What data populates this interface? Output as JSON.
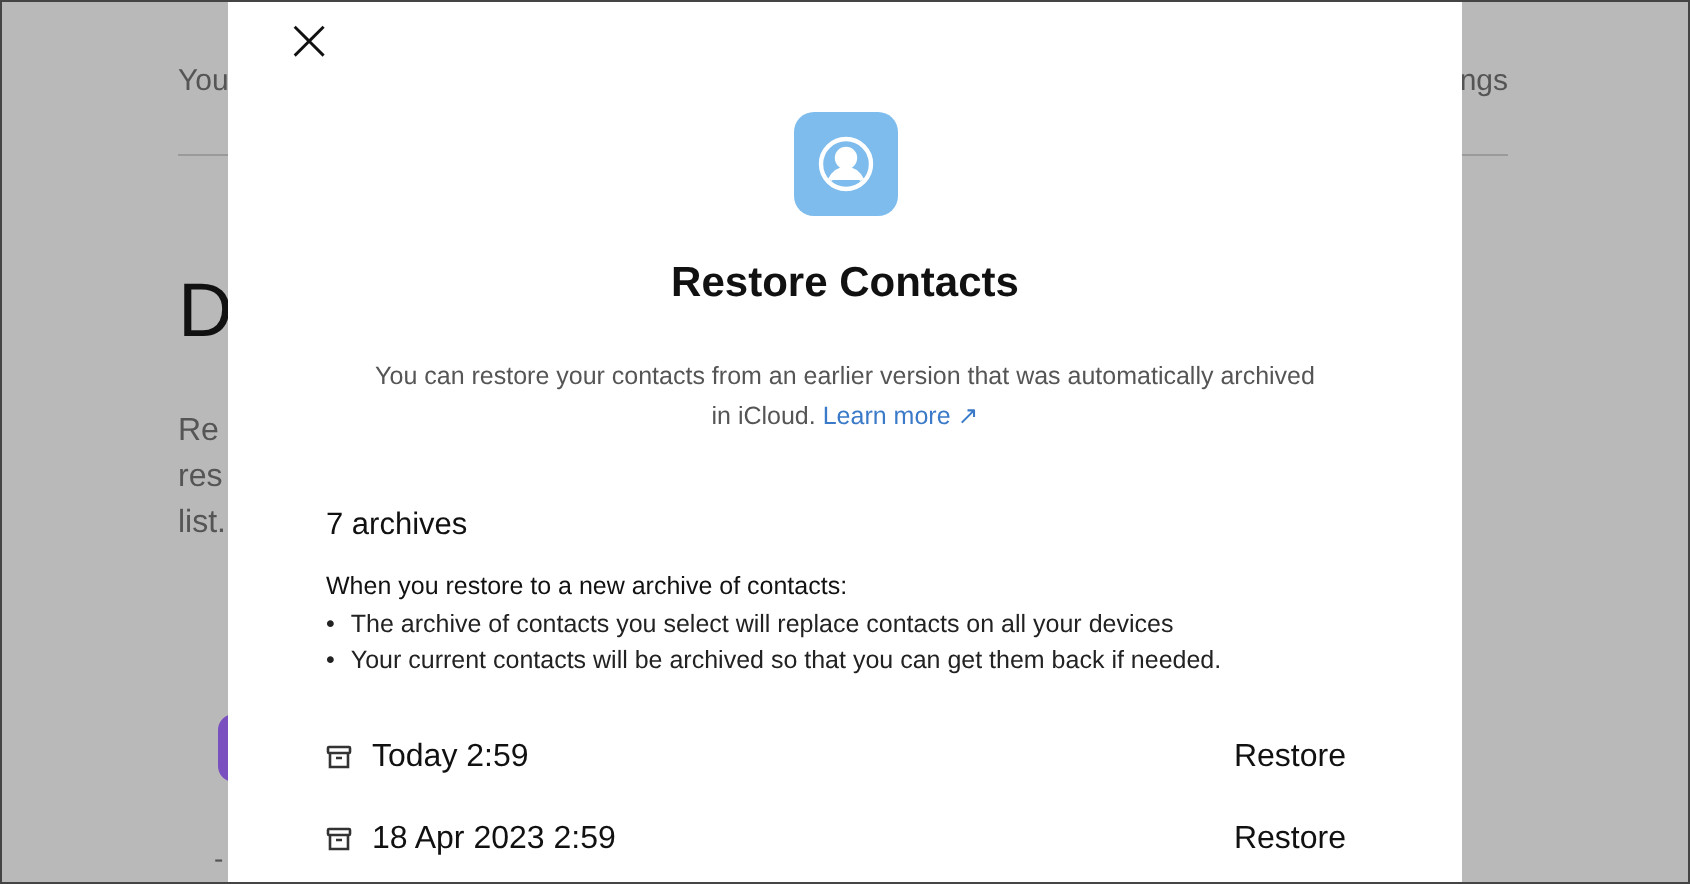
{
  "background_page": {
    "header_left": "You",
    "header_right": "ngs",
    "heading": "D",
    "paragraph_lines": [
      "Re",
      "res",
      "list."
    ],
    "footer_mark": "-"
  },
  "dialog": {
    "close": "×",
    "title": "Restore Contacts",
    "description": "You can restore your contacts from an earlier version that was automatically archived in iCloud.",
    "link": "Learn more ↗",
    "archive_count": "7 archives",
    "intro": "When you restore to a new archive of contacts:",
    "bullets": [
      {
        "marker": "•",
        "text": "The archive of contacts you select will replace contacts on all your devices"
      },
      {
        "marker": "•",
        "text": "Your current contacts will be archived so that you can get them back if needed."
      }
    ],
    "archives": [
      {
        "date": "Today 2:59",
        "action": "Restore"
      },
      {
        "date": "18 Apr 2023 2:59",
        "action": "Restore"
      }
    ]
  }
}
